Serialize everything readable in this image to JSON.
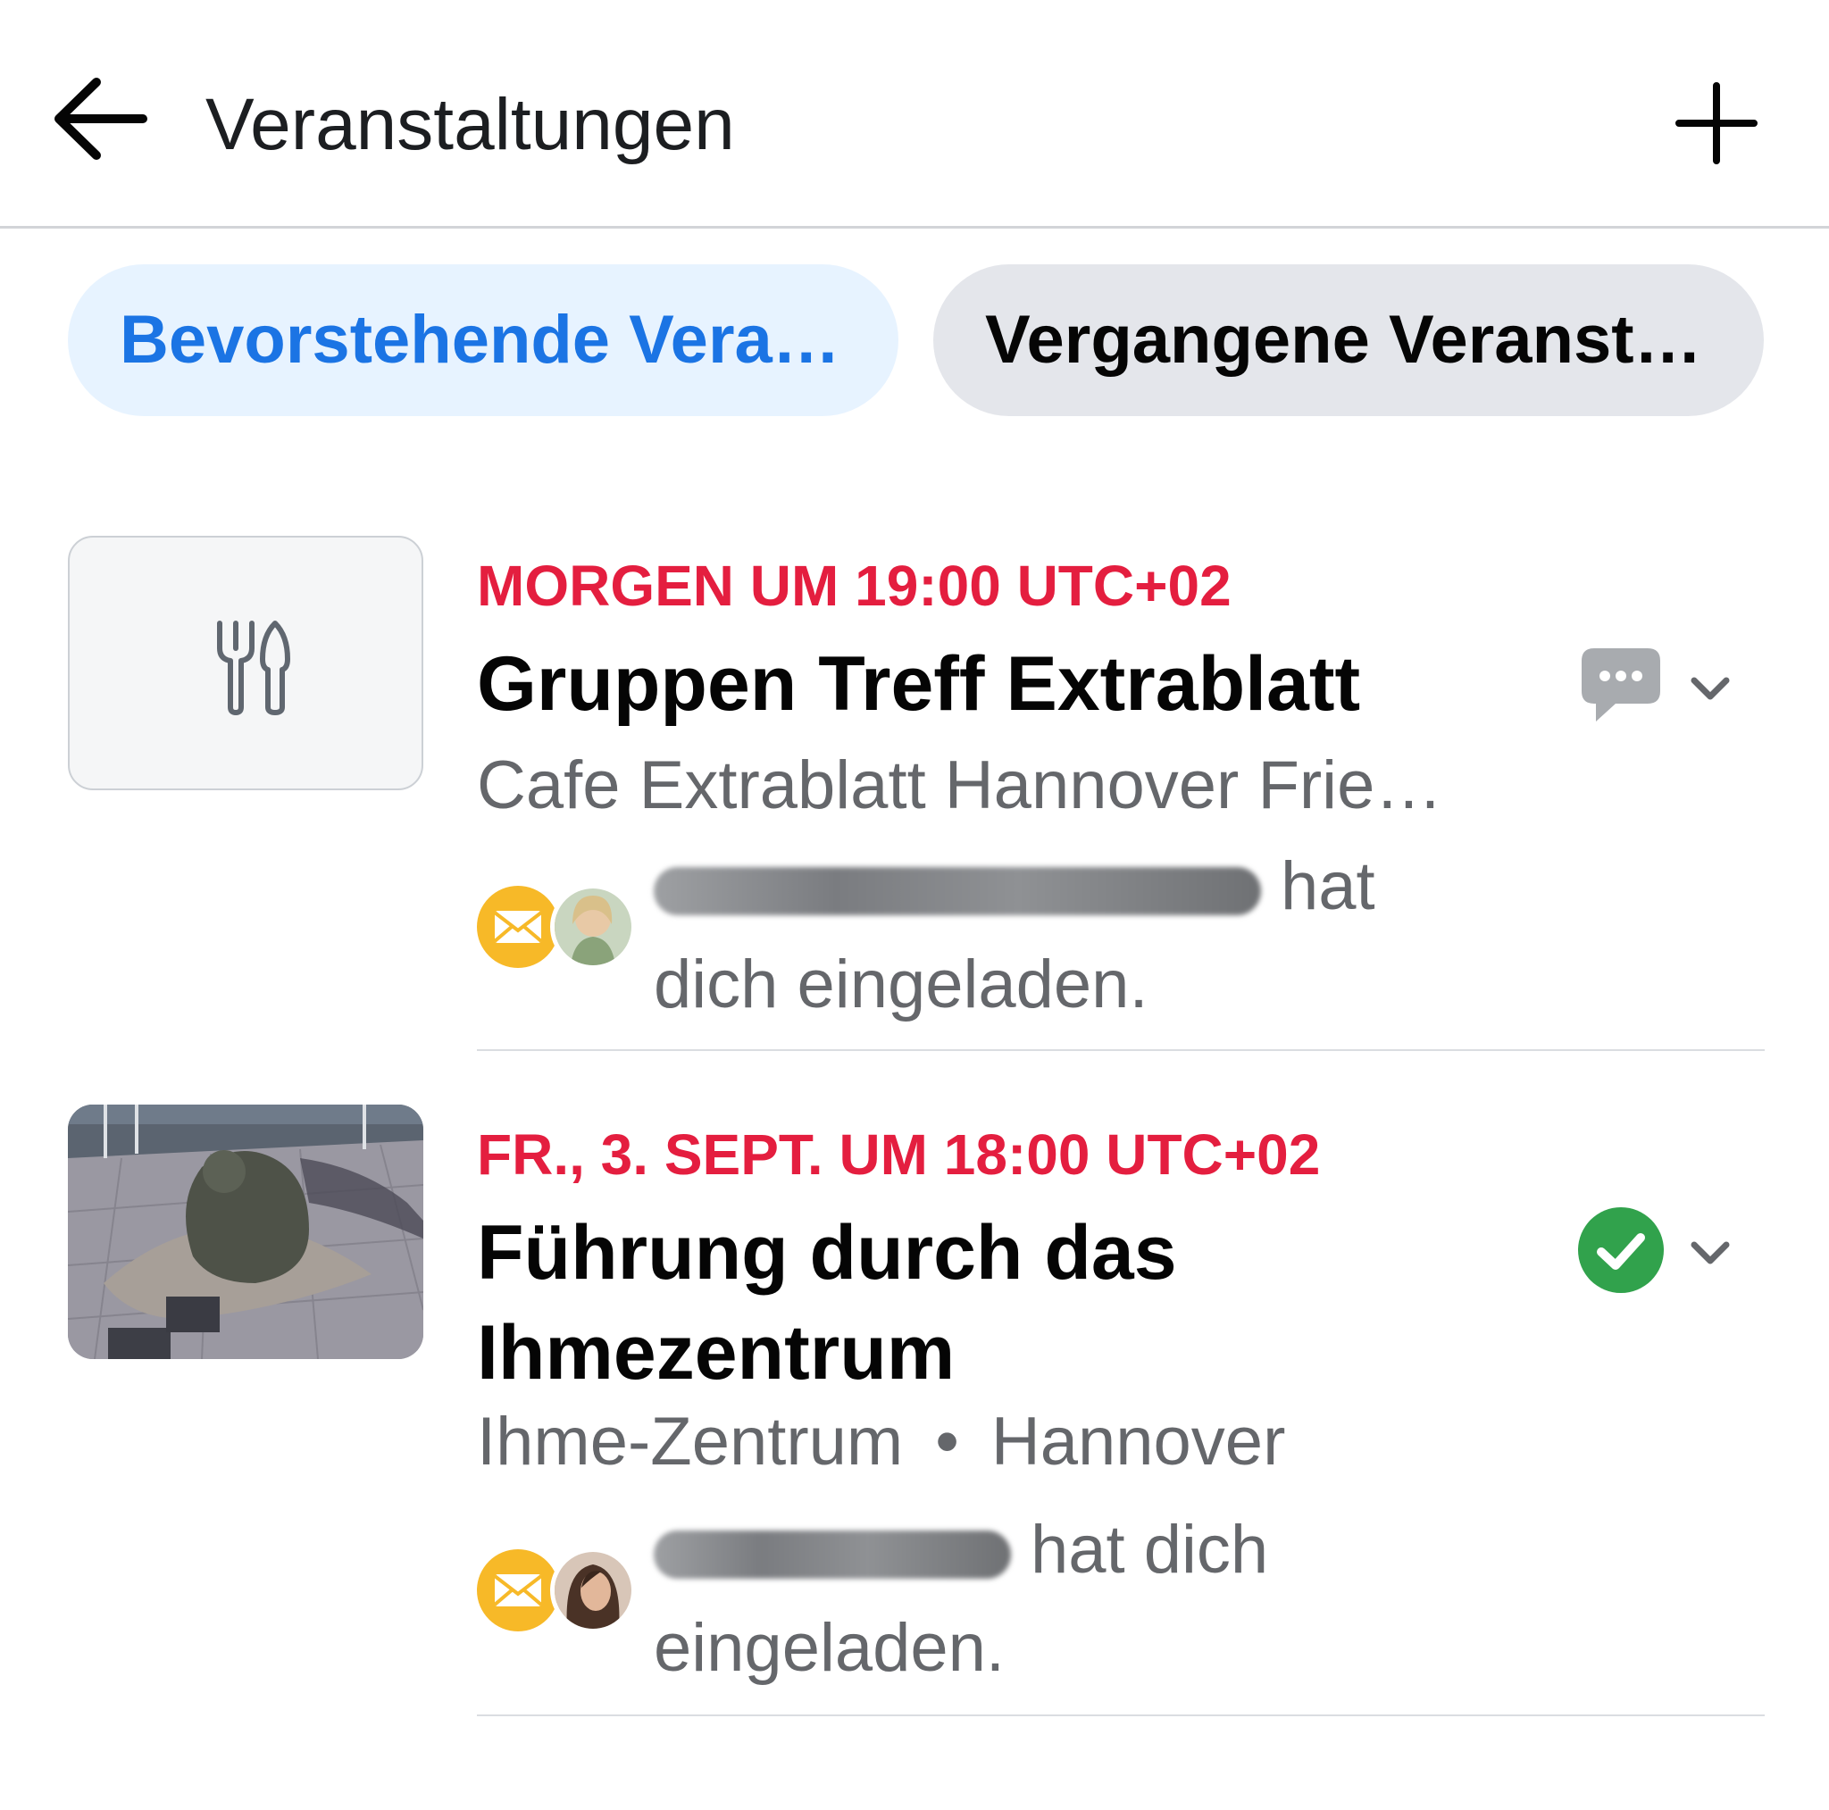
{
  "header": {
    "title": "Veranstaltungen",
    "back_icon": "arrow-left-icon",
    "add_icon": "plus-icon"
  },
  "tabs": [
    {
      "label": "Bevorstehende Vera…",
      "selected": true
    },
    {
      "label": "Vergangene Veranst…",
      "selected": false
    }
  ],
  "events": [
    {
      "time": "MORGEN UM 19:00 UTC+02",
      "title": "Gruppen Treff Extrablatt",
      "location": "Cafe Extrablatt Hannover Frie…",
      "invite_text": "hat dich eingeladen.",
      "invite_text_line1": "hat",
      "invite_text_line2": "dich eingeladen.",
      "thumbnail_icon": "fork-knife-icon",
      "status_icon": "chat-bubble-icon"
    },
    {
      "time": "FR., 3. SEPT. UM 18:00 UTC+02",
      "title": "Führung durch das Ihmezentrum",
      "location_part1": "Ihme-Zentrum",
      "location_sep": "•",
      "location_part2": "Hannover",
      "invite_text_line1": "hat dich",
      "invite_text_line2": "eingeladen.",
      "thumbnail_icon": "bear-statue-photo",
      "status_icon": "check-circle-icon"
    }
  ],
  "colors": {
    "accent_blue": "#1b74e4",
    "tab_selected_bg": "#e7f3ff",
    "tab_bg": "#e4e6eb",
    "date_red": "#e41e3f",
    "secondary_text": "#65676b",
    "going_green": "#31a24c",
    "invite_yellow": "#f7b928"
  }
}
